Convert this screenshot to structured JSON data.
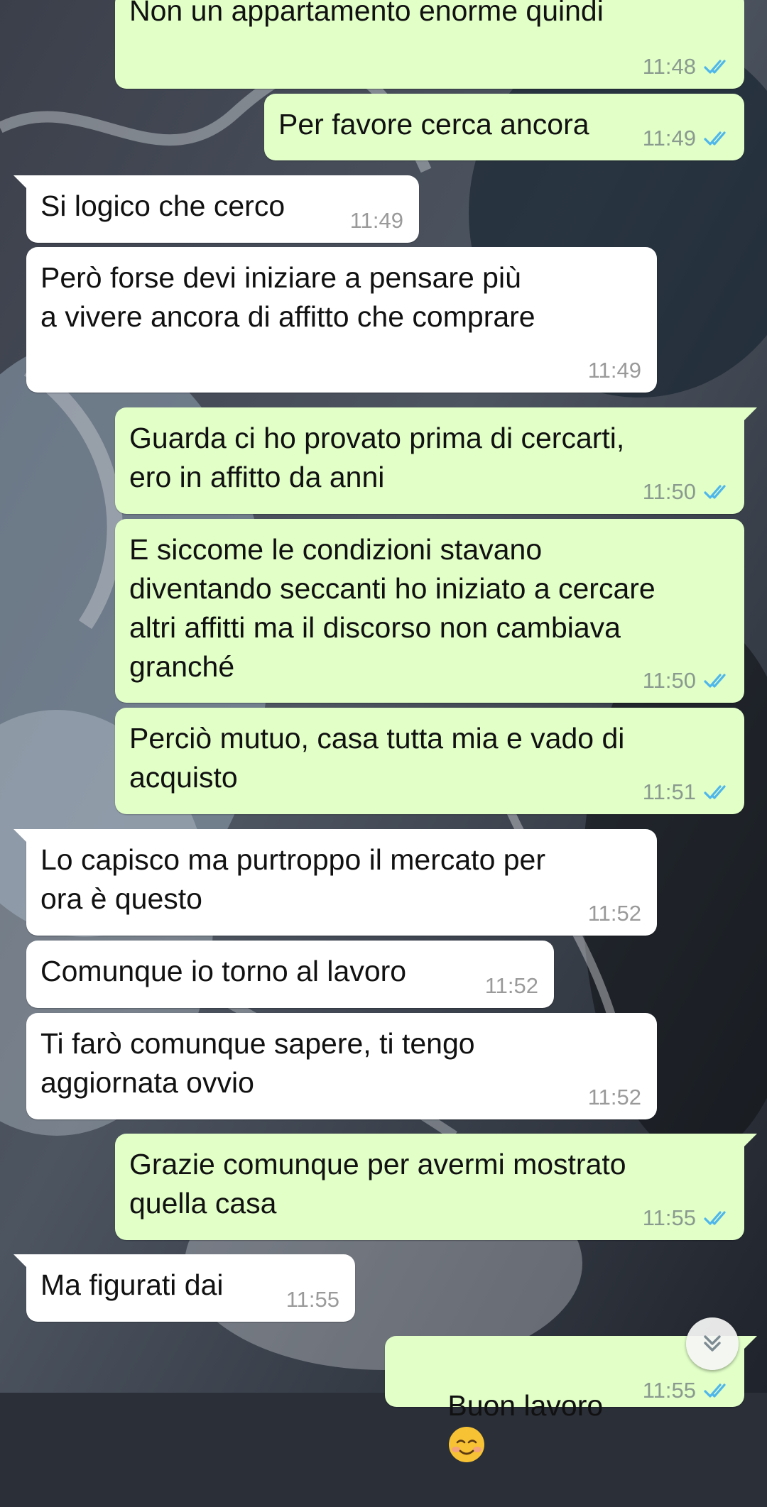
{
  "chat": {
    "messages": [
      {
        "text": "Non un appartamento enorme quindi",
        "time": "11:48",
        "dir": "out"
      },
      {
        "text": "Per favore cerca ancora",
        "time": "11:49",
        "dir": "out"
      },
      {
        "text": "Si logico che cerco",
        "time": "11:49",
        "dir": "in"
      },
      {
        "text": "Però forse devi iniziare a pensare più\na vivere ancora di affitto che comprare",
        "time": "11:49",
        "dir": "in"
      },
      {
        "text": "Guarda ci ho provato prima di cercarti,\nero in affitto da anni",
        "time": "11:50",
        "dir": "out"
      },
      {
        "text": "E siccome le condizioni stavano\ndiventando seccanti ho iniziato a cercare\naltri affitti ma il discorso non cambiava\ngranché",
        "time": "11:50",
        "dir": "out"
      },
      {
        "text": "Perciò mutuo, casa tutta mia e vado di\nacquisto",
        "time": "11:51",
        "dir": "out"
      },
      {
        "text": "Lo capisco ma purtroppo il mercato per\nora è questo",
        "time": "11:52",
        "dir": "in"
      },
      {
        "text": "Comunque io torno al lavoro",
        "time": "11:52",
        "dir": "in"
      },
      {
        "text": "Ti farò comunque sapere, ti tengo\naggiornata ovvio",
        "time": "11:52",
        "dir": "in"
      },
      {
        "text": "Grazie comunque per avermi mostrato\nquella casa",
        "time": "11:55",
        "dir": "out"
      },
      {
        "text": "Ma figurati dai",
        "time": "11:55",
        "dir": "in"
      },
      {
        "text": "Buon lavoro",
        "emoji": "smiling-face-emoji",
        "time": "11:55",
        "dir": "out"
      }
    ]
  },
  "icons": {
    "read_receipt": "double-check-icon",
    "scroll_down": "double-chevron-down-icon"
  },
  "colors": {
    "incoming_bubble": "#ffffff",
    "outgoing_bubble": "#e1ffc7",
    "read_ticks": "#4fb6ec",
    "timestamp": "#8a9a8f"
  }
}
